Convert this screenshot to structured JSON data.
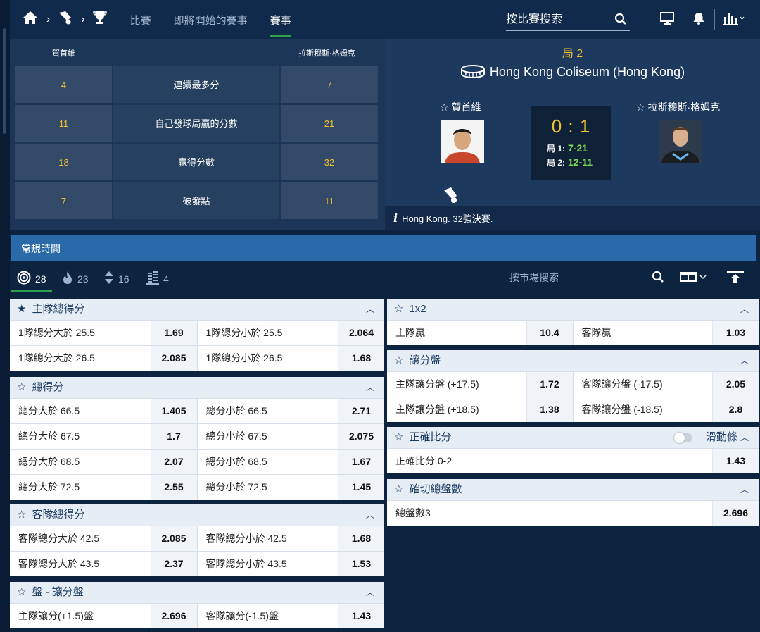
{
  "nav": {
    "links": [
      "比賽",
      "即將開始的賽事",
      "賽事"
    ],
    "search_placeholder": "按比賽搜索"
  },
  "stats": {
    "home_name": "賀首維",
    "away_name": "拉斯穆斯·格姆克",
    "rows": [
      {
        "home": "4",
        "label": "連續最多分",
        "away": "7"
      },
      {
        "home": "11",
        "label": "自己發球局贏的分數",
        "away": "21"
      },
      {
        "home": "18",
        "label": "贏得分數",
        "away": "32"
      },
      {
        "home": "7",
        "label": "破發點",
        "away": "11"
      }
    ]
  },
  "match": {
    "period": "局 2",
    "venue": "Hong Kong Coliseum (Hong Kong)",
    "home": "賀首維",
    "away": "拉斯穆斯·格姆克",
    "score": "0 : 1",
    "set1_label": "局 1:",
    "set1_score": "7-21",
    "set2_label": "局 2:",
    "set2_score": "12-11",
    "info": "Hong Kong. 32強決賽."
  },
  "regular_time": "常規時間",
  "filters": {
    "all": "28",
    "hot": "23",
    "updown": "16",
    "list": "4",
    "market_search_placeholder": "按市場搜索"
  },
  "markets_left": [
    {
      "title": "主隊總得分",
      "starred": true,
      "rows": [
        {
          "l1": "1隊總分大於 25.5",
          "o1": "1.69",
          "l2": "1隊總分小於 25.5",
          "o2": "2.064"
        },
        {
          "l1": "1隊總分大於 26.5",
          "o1": "2.085",
          "l2": "1隊總分小於 26.5",
          "o2": "1.68"
        }
      ]
    },
    {
      "title": "總得分",
      "starred": false,
      "rows": [
        {
          "l1": "總分大於 66.5",
          "o1": "1.405",
          "l2": "總分小於 66.5",
          "o2": "2.71"
        },
        {
          "l1": "總分大於 67.5",
          "o1": "1.7",
          "l2": "總分小於 67.5",
          "o2": "2.075"
        },
        {
          "l1": "總分大於 68.5",
          "o1": "2.07",
          "l2": "總分小於 68.5",
          "o2": "1.67"
        },
        {
          "l1": "總分大於 72.5",
          "o1": "2.55",
          "l2": "總分小於 72.5",
          "o2": "1.45"
        }
      ]
    },
    {
      "title": "客隊總得分",
      "starred": false,
      "rows": [
        {
          "l1": "客隊總分大於 42.5",
          "o1": "2.085",
          "l2": "客隊總分小於 42.5",
          "o2": "1.68"
        },
        {
          "l1": "客隊總分大於 43.5",
          "o1": "2.37",
          "l2": "客隊總分小於 43.5",
          "o2": "1.53"
        }
      ]
    },
    {
      "title": "盤 - 讓分盤",
      "starred": false,
      "rows": [
        {
          "l1": "主隊讓分(+1.5)盤",
          "o1": "2.696",
          "l2": "客隊讓分(-1.5)盤",
          "o2": "1.43"
        }
      ]
    }
  ],
  "markets_right": [
    {
      "title": "1x2",
      "rows": [
        {
          "l1": "主隊贏",
          "o1": "10.4",
          "l2": "客隊贏",
          "o2": "1.03"
        }
      ]
    },
    {
      "title": "讓分盤",
      "rows": [
        {
          "l1": "主隊讓分盤 (+17.5)",
          "o1": "1.72",
          "l2": "客隊讓分盤 (-17.5)",
          "o2": "2.05"
        },
        {
          "l1": "主隊讓分盤 (+18.5)",
          "o1": "1.38",
          "l2": "客隊讓分盤 (-18.5)",
          "o2": "2.8"
        }
      ]
    },
    {
      "title": "正確比分",
      "slide_label": "滑動條",
      "rows": [
        {
          "l1": "正確比分 0-2",
          "o1": "1.43"
        }
      ]
    },
    {
      "title": "確切總盤數",
      "rows": [
        {
          "l1": "總盤數3",
          "o1": "2.696"
        }
      ]
    }
  ]
}
